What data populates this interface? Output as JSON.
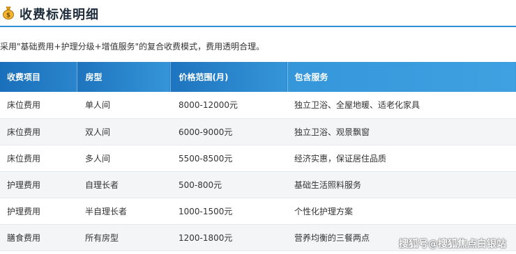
{
  "header": {
    "icon": "money-bag-icon",
    "title": "收费标准明细"
  },
  "intro": "采用\"基础费用+护理分级+增值服务\"的复合收费模式，费用透明合理。",
  "table": {
    "columns": [
      "收费项目",
      "房型",
      "价格范围(月)",
      "包含服务"
    ],
    "rows": [
      [
        "床位费用",
        "单人间",
        "8000-12000元",
        "独立卫浴、全屋地暖、适老化家具"
      ],
      [
        "床位费用",
        "双人间",
        "6000-9000元",
        "独立卫浴、观景飘窗"
      ],
      [
        "床位费用",
        "多人间",
        "5500-8500元",
        "经济实惠，保证居住品质"
      ],
      [
        "护理费用",
        "自理长者",
        "500-800元",
        "基础生活照料服务"
      ],
      [
        "护理费用",
        "半自理长者",
        "1000-1500元",
        "个性化护理方案"
      ],
      [
        "膳食费用",
        "所有房型",
        "1200-1800元",
        "营养均衡的三餐两点"
      ]
    ]
  },
  "watermark": "搜狐号@搜狐焦点白银站",
  "colors": {
    "accent": "#2f8fd1",
    "header_bg": "#2a85cc",
    "row_alt": "#f3f5f7"
  }
}
